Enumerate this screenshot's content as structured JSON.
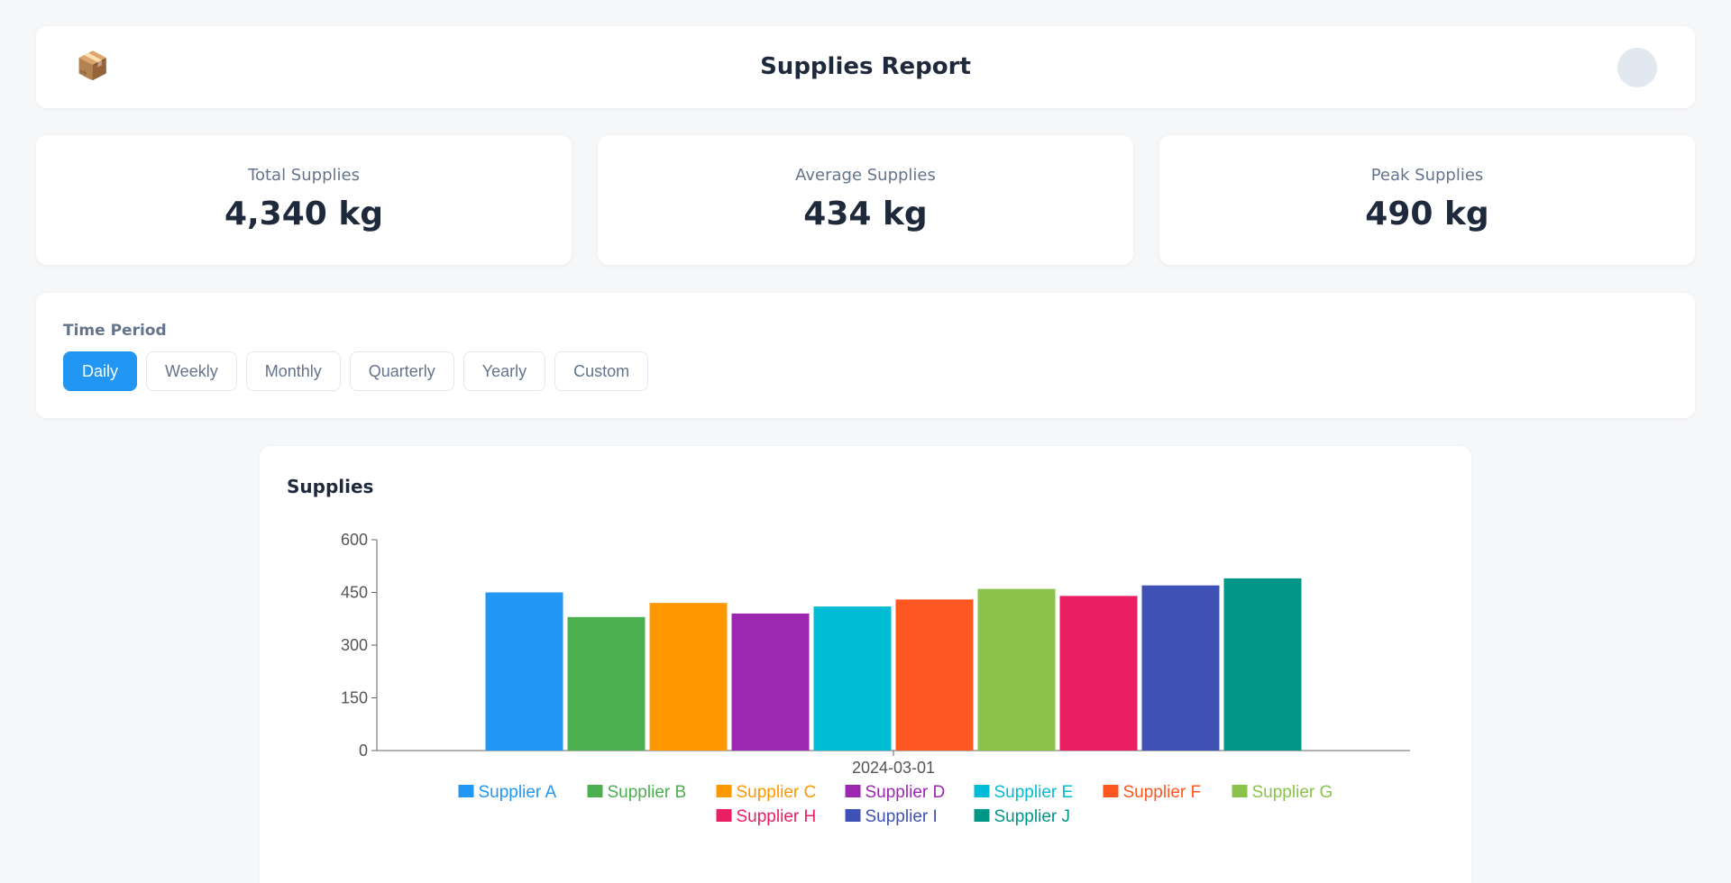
{
  "header": {
    "logo_icon": "📦",
    "title": "Supplies Report"
  },
  "stats": [
    {
      "label": "Total Supplies",
      "value": "4,340 kg"
    },
    {
      "label": "Average Supplies",
      "value": "434 kg"
    },
    {
      "label": "Peak Supplies",
      "value": "490 kg"
    }
  ],
  "period": {
    "label": "Time Period",
    "options": [
      "Daily",
      "Weekly",
      "Monthly",
      "Quarterly",
      "Yearly",
      "Custom"
    ],
    "selected": "Daily",
    "accent": "#2196f3"
  },
  "chart": {
    "title": "Supplies"
  },
  "chart_data": {
    "type": "bar",
    "categories": [
      "2024-03-01"
    ],
    "ylim": [
      0,
      600
    ],
    "yticks": [
      0,
      150,
      300,
      450,
      600
    ],
    "grid": false,
    "legend": "bottom",
    "series": [
      {
        "name": "Supplier A",
        "values": [
          450
        ],
        "color": "#2196f3"
      },
      {
        "name": "Supplier B",
        "values": [
          380
        ],
        "color": "#4caf50"
      },
      {
        "name": "Supplier C",
        "values": [
          420
        ],
        "color": "#ff9800"
      },
      {
        "name": "Supplier D",
        "values": [
          390
        ],
        "color": "#9c27b0"
      },
      {
        "name": "Supplier E",
        "values": [
          410
        ],
        "color": "#00bcd4"
      },
      {
        "name": "Supplier F",
        "values": [
          430
        ],
        "color": "#ff5722"
      },
      {
        "name": "Supplier G",
        "values": [
          460
        ],
        "color": "#8bc34a"
      },
      {
        "name": "Supplier H",
        "values": [
          440
        ],
        "color": "#e91e63"
      },
      {
        "name": "Supplier I",
        "values": [
          470
        ],
        "color": "#3f51b5"
      },
      {
        "name": "Supplier J",
        "values": [
          490
        ],
        "color": "#009688"
      }
    ]
  }
}
